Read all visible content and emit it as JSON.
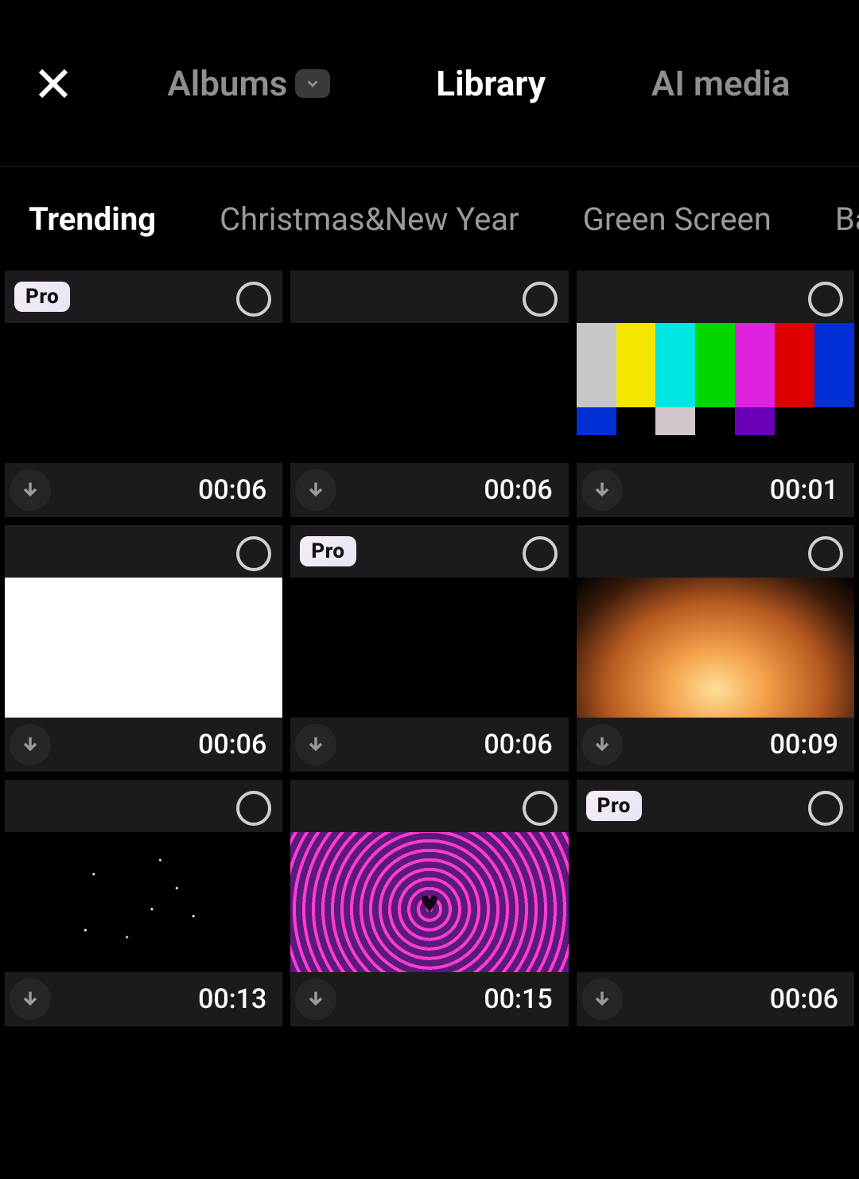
{
  "header": {
    "tabs": [
      {
        "label": "Albums",
        "hasDropdown": true,
        "active": false
      },
      {
        "label": "Library",
        "hasDropdown": false,
        "active": true
      },
      {
        "label": "AI media",
        "hasDropdown": false,
        "active": false
      }
    ]
  },
  "categories": [
    {
      "label": "Trending",
      "active": true
    },
    {
      "label": "Christmas&New Year",
      "active": false
    },
    {
      "label": "Green Screen",
      "active": false
    },
    {
      "label": "Background",
      "active": false
    }
  ],
  "pro_label": "Pro",
  "clips": [
    {
      "pro": true,
      "thumb": "black",
      "duration": "00:06"
    },
    {
      "pro": false,
      "thumb": "black",
      "duration": "00:06"
    },
    {
      "pro": false,
      "thumb": "colorbars",
      "duration": "00:01"
    },
    {
      "pro": false,
      "thumb": "white",
      "duration": "00:06"
    },
    {
      "pro": true,
      "thumb": "black",
      "duration": "00:06"
    },
    {
      "pro": false,
      "thumb": "fire",
      "duration": "00:09"
    },
    {
      "pro": false,
      "thumb": "stars",
      "duration": "00:13"
    },
    {
      "pro": false,
      "thumb": "hearts",
      "duration": "00:15"
    },
    {
      "pro": true,
      "thumb": "black",
      "duration": "00:06"
    }
  ]
}
